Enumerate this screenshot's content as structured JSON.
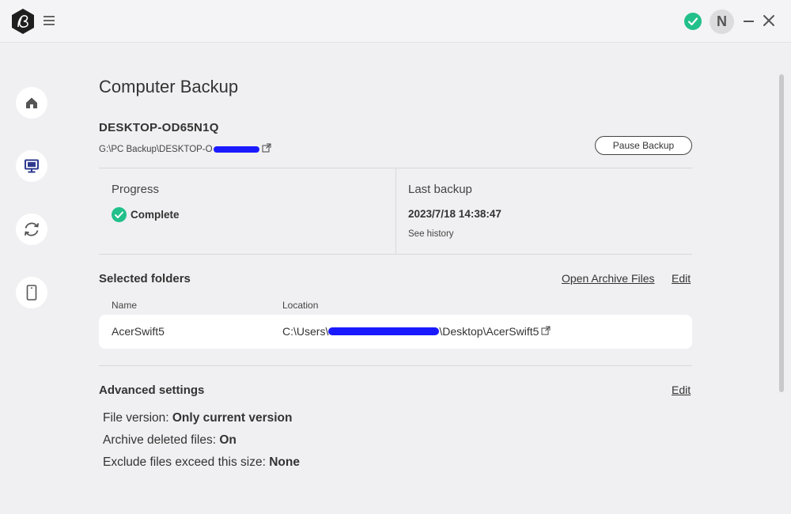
{
  "header": {
    "avatar_initial": "N"
  },
  "page": {
    "title": "Computer Backup"
  },
  "device": {
    "name": "DESKTOP-OD65N1Q",
    "path_prefix": "G:\\PC Backup\\DESKTOP-O",
    "pause_label": "Pause Backup"
  },
  "progress": {
    "label": "Progress",
    "status": "Complete"
  },
  "last_backup": {
    "label": "Last backup",
    "time": "2023/7/18 14:38:47",
    "history_link": "See history"
  },
  "folders": {
    "title": "Selected folders",
    "open_archive": "Open Archive Files",
    "edit": "Edit",
    "col_name": "Name",
    "col_location": "Location",
    "rows": [
      {
        "name": "AcerSwift5",
        "location_prefix": "C:\\Users\\",
        "location_suffix": "\\Desktop\\AcerSwift5"
      }
    ]
  },
  "advanced": {
    "title": "Advanced settings",
    "edit": "Edit",
    "file_version_label": "File version: ",
    "file_version_value": "Only current version",
    "archive_deleted_label": "Archive deleted files: ",
    "archive_deleted_value": "On",
    "exclude_label": "Exclude files exceed this size: ",
    "exclude_value": "None"
  },
  "colors": {
    "accent_green": "#22c08a",
    "nav_active": "#2f3a8f",
    "background": "#f0f0f2"
  },
  "icons": {
    "logo": "app-logo-hexagon",
    "menu": "hamburger-icon",
    "home": "home-icon",
    "computer": "monitor-icon",
    "sync": "sync-icon",
    "phone": "phone-icon",
    "status": "check-circle-icon",
    "external": "external-link-icon"
  }
}
